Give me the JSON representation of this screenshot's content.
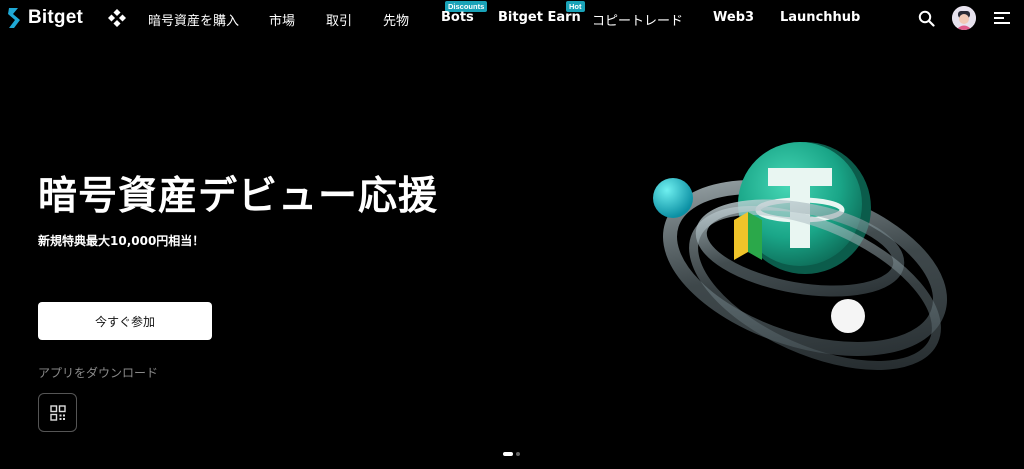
{
  "nav": {
    "logo_text": "Bitget",
    "items": [
      {
        "label": "暗号資産を購入"
      },
      {
        "label": "市場"
      },
      {
        "label": "取引"
      },
      {
        "label": "先物"
      },
      {
        "label": "Bots",
        "badge": "Discounts"
      },
      {
        "label": "Bitget Earn",
        "badge": "Hot"
      },
      {
        "label": "コピートレード"
      },
      {
        "label": "Web3"
      },
      {
        "label": "Launchhub"
      }
    ],
    "icons": [
      "grid-icon",
      "search-icon",
      "avatar",
      "menu-icon"
    ]
  },
  "hero": {
    "title": "暗号資産デビュー応援",
    "subtitle": "新規特典最大10,000円相当！",
    "join_button": "今すぐ参加",
    "app_label": "アプリをダウンロード"
  },
  "colors": {
    "background": "#000000",
    "badge": "#1aa3b8",
    "accent_teal": "#1fb8a0",
    "logo_blue": "#1fa9d6"
  },
  "carousel": {
    "total": 2,
    "active": 1
  }
}
